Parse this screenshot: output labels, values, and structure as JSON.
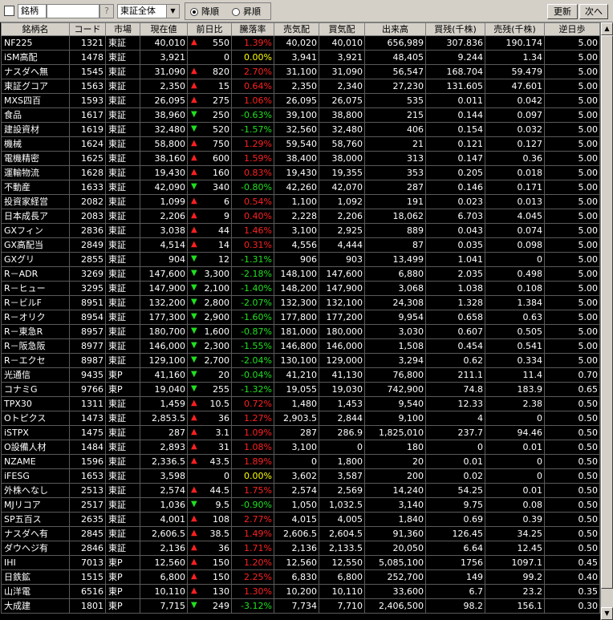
{
  "toolbar": {
    "field_label": "銘柄",
    "field_value": "",
    "help_label": "?",
    "market_select": "東証全体",
    "sort_desc_label": "降順",
    "sort_asc_label": "昇順",
    "sort_selected": "desc",
    "update_label": "更新",
    "next_label": "次へ"
  },
  "colors": {
    "up": "#ff2020",
    "down": "#20e020",
    "flat": "#ffff00",
    "background": "#000000",
    "header_bg": "#d4d0c8"
  },
  "columns": [
    "銘柄名",
    "コード",
    "市場",
    "現在値",
    "前日比",
    "騰落率",
    "売気配",
    "買気配",
    "出来高",
    "買残(千株)",
    "売残(千株)",
    "逆日歩"
  ],
  "rows": [
    {
      "name": "NF225",
      "code": "1321",
      "market": "東証",
      "price": "40,010",
      "dir": "up",
      "change": "550",
      "rate": "1.39%",
      "ask": "40,020",
      "bid": "40,010",
      "volume": "656,989",
      "buy_rem": "307.836",
      "sell_rem": "190.174",
      "gyaku": "5.00"
    },
    {
      "name": "iSM高配",
      "code": "1478",
      "market": "東証",
      "price": "3,921",
      "dir": "flat",
      "change": "0",
      "rate": "0.00%",
      "ask": "3,941",
      "bid": "3,921",
      "volume": "48,405",
      "buy_rem": "9.244",
      "sell_rem": "1.34",
      "gyaku": "5.00"
    },
    {
      "name": "ナスダへ無",
      "code": "1545",
      "market": "東証",
      "price": "31,090",
      "dir": "up",
      "change": "820",
      "rate": "2.70%",
      "ask": "31,100",
      "bid": "31,090",
      "volume": "56,547",
      "buy_rem": "168.704",
      "sell_rem": "59.479",
      "gyaku": "5.00"
    },
    {
      "name": "東証グコア",
      "code": "1563",
      "market": "東証",
      "price": "2,350",
      "dir": "up",
      "change": "15",
      "rate": "0.64%",
      "ask": "2,350",
      "bid": "2,340",
      "volume": "27,230",
      "buy_rem": "131.605",
      "sell_rem": "47.601",
      "gyaku": "5.00"
    },
    {
      "name": "MXS四百",
      "code": "1593",
      "market": "東証",
      "price": "26,095",
      "dir": "up",
      "change": "275",
      "rate": "1.06%",
      "ask": "26,095",
      "bid": "26,075",
      "volume": "535",
      "buy_rem": "0.011",
      "sell_rem": "0.042",
      "gyaku": "5.00"
    },
    {
      "name": "食品",
      "code": "1617",
      "market": "東証",
      "price": "38,960",
      "dir": "down",
      "change": "250",
      "rate": "-0.63%",
      "ask": "39,100",
      "bid": "38,800",
      "volume": "215",
      "buy_rem": "0.144",
      "sell_rem": "0.097",
      "gyaku": "5.00"
    },
    {
      "name": "建設資材",
      "code": "1619",
      "market": "東証",
      "price": "32,480",
      "dir": "down",
      "change": "520",
      "rate": "-1.57%",
      "ask": "32,560",
      "bid": "32,480",
      "volume": "406",
      "buy_rem": "0.154",
      "sell_rem": "0.032",
      "gyaku": "5.00"
    },
    {
      "name": "機械",
      "code": "1624",
      "market": "東証",
      "price": "58,800",
      "dir": "up",
      "change": "750",
      "rate": "1.29%",
      "ask": "59,540",
      "bid": "58,760",
      "volume": "21",
      "buy_rem": "0.121",
      "sell_rem": "0.127",
      "gyaku": "5.00"
    },
    {
      "name": "電機精密",
      "code": "1625",
      "market": "東証",
      "price": "38,160",
      "dir": "up",
      "change": "600",
      "rate": "1.59%",
      "ask": "38,400",
      "bid": "38,000",
      "volume": "313",
      "buy_rem": "0.147",
      "sell_rem": "0.36",
      "gyaku": "5.00"
    },
    {
      "name": "運輸物流",
      "code": "1628",
      "market": "東証",
      "price": "19,430",
      "dir": "up",
      "change": "160",
      "rate": "0.83%",
      "ask": "19,430",
      "bid": "19,355",
      "volume": "353",
      "buy_rem": "0.205",
      "sell_rem": "0.018",
      "gyaku": "5.00"
    },
    {
      "name": "不動産",
      "code": "1633",
      "market": "東証",
      "price": "42,090",
      "dir": "down",
      "change": "340",
      "rate": "-0.80%",
      "ask": "42,260",
      "bid": "42,070",
      "volume": "287",
      "buy_rem": "0.146",
      "sell_rem": "0.171",
      "gyaku": "5.00"
    },
    {
      "name": "投資家経営",
      "code": "2082",
      "market": "東証",
      "price": "1,099",
      "dir": "up",
      "change": "6",
      "rate": "0.54%",
      "ask": "1,100",
      "bid": "1,092",
      "volume": "191",
      "buy_rem": "0.023",
      "sell_rem": "0.013",
      "gyaku": "5.00"
    },
    {
      "name": "日本成長ア",
      "code": "2083",
      "market": "東証",
      "price": "2,206",
      "dir": "up",
      "change": "9",
      "rate": "0.40%",
      "ask": "2,228",
      "bid": "2,206",
      "volume": "18,062",
      "buy_rem": "6.703",
      "sell_rem": "4.045",
      "gyaku": "5.00"
    },
    {
      "name": "GXフィン",
      "code": "2836",
      "market": "東証",
      "price": "3,038",
      "dir": "up",
      "change": "44",
      "rate": "1.46%",
      "ask": "3,100",
      "bid": "2,925",
      "volume": "889",
      "buy_rem": "0.043",
      "sell_rem": "0.074",
      "gyaku": "5.00"
    },
    {
      "name": "GX高配当",
      "code": "2849",
      "market": "東証",
      "price": "4,514",
      "dir": "up",
      "change": "14",
      "rate": "0.31%",
      "ask": "4,556",
      "bid": "4,444",
      "volume": "87",
      "buy_rem": "0.035",
      "sell_rem": "0.098",
      "gyaku": "5.00"
    },
    {
      "name": "GXグリ",
      "code": "2855",
      "market": "東証",
      "price": "904",
      "dir": "down",
      "change": "12",
      "rate": "-1.31%",
      "ask": "906",
      "bid": "903",
      "volume": "13,499",
      "buy_rem": "1.041",
      "sell_rem": "0",
      "gyaku": "5.00"
    },
    {
      "name": "R－ADR",
      "code": "3269",
      "market": "東証",
      "price": "147,600",
      "dir": "down",
      "change": "3,300",
      "rate": "-2.18%",
      "ask": "148,100",
      "bid": "147,600",
      "volume": "6,880",
      "buy_rem": "2.035",
      "sell_rem": "0.498",
      "gyaku": "5.00"
    },
    {
      "name": "R－ヒュー",
      "code": "3295",
      "market": "東証",
      "price": "147,900",
      "dir": "down",
      "change": "2,100",
      "rate": "-1.40%",
      "ask": "148,200",
      "bid": "147,900",
      "volume": "3,068",
      "buy_rem": "1.038",
      "sell_rem": "0.108",
      "gyaku": "5.00"
    },
    {
      "name": "R－ビルF",
      "code": "8951",
      "market": "東証",
      "price": "132,200",
      "dir": "down",
      "change": "2,800",
      "rate": "-2.07%",
      "ask": "132,300",
      "bid": "132,100",
      "volume": "24,308",
      "buy_rem": "1.328",
      "sell_rem": "1.384",
      "gyaku": "5.00"
    },
    {
      "name": "R－オリク",
      "code": "8954",
      "market": "東証",
      "price": "177,300",
      "dir": "down",
      "change": "2,900",
      "rate": "-1.60%",
      "ask": "177,800",
      "bid": "177,200",
      "volume": "9,954",
      "buy_rem": "0.658",
      "sell_rem": "0.63",
      "gyaku": "5.00"
    },
    {
      "name": "R－東急R",
      "code": "8957",
      "market": "東証",
      "price": "180,700",
      "dir": "down",
      "change": "1,600",
      "rate": "-0.87%",
      "ask": "181,000",
      "bid": "180,000",
      "volume": "3,030",
      "buy_rem": "0.607",
      "sell_rem": "0.505",
      "gyaku": "5.00"
    },
    {
      "name": "R－阪急阪",
      "code": "8977",
      "market": "東証",
      "price": "146,000",
      "dir": "down",
      "change": "2,300",
      "rate": "-1.55%",
      "ask": "146,800",
      "bid": "146,000",
      "volume": "1,508",
      "buy_rem": "0.454",
      "sell_rem": "0.541",
      "gyaku": "5.00"
    },
    {
      "name": "R－エクセ",
      "code": "8987",
      "market": "東証",
      "price": "129,100",
      "dir": "down",
      "change": "2,700",
      "rate": "-2.04%",
      "ask": "130,100",
      "bid": "129,000",
      "volume": "3,294",
      "buy_rem": "0.62",
      "sell_rem": "0.334",
      "gyaku": "5.00"
    },
    {
      "name": "光通信",
      "code": "9435",
      "market": "東P",
      "price": "41,160",
      "dir": "down",
      "change": "20",
      "rate": "-0.04%",
      "ask": "41,210",
      "bid": "41,130",
      "volume": "76,800",
      "buy_rem": "211.1",
      "sell_rem": "11.4",
      "gyaku": "0.70"
    },
    {
      "name": "コナミG",
      "code": "9766",
      "market": "東P",
      "price": "19,040",
      "dir": "down",
      "change": "255",
      "rate": "-1.32%",
      "ask": "19,055",
      "bid": "19,030",
      "volume": "742,900",
      "buy_rem": "74.8",
      "sell_rem": "183.9",
      "gyaku": "0.65"
    },
    {
      "name": "TPX30",
      "code": "1311",
      "market": "東証",
      "price": "1,459",
      "dir": "up",
      "change": "10.5",
      "rate": "0.72%",
      "ask": "1,480",
      "bid": "1,453",
      "volume": "9,540",
      "buy_rem": "12.33",
      "sell_rem": "2.38",
      "gyaku": "0.50"
    },
    {
      "name": "Oトピクス",
      "code": "1473",
      "market": "東証",
      "price": "2,853.5",
      "dir": "up",
      "change": "36",
      "rate": "1.27%",
      "ask": "2,903.5",
      "bid": "2,844",
      "volume": "9,100",
      "buy_rem": "4",
      "sell_rem": "0",
      "gyaku": "0.50"
    },
    {
      "name": "iSTPX",
      "code": "1475",
      "market": "東証",
      "price": "287",
      "dir": "up",
      "change": "3.1",
      "rate": "1.09%",
      "ask": "287",
      "bid": "286.9",
      "volume": "1,825,010",
      "buy_rem": "237.7",
      "sell_rem": "94.46",
      "gyaku": "0.50"
    },
    {
      "name": "O設備人材",
      "code": "1484",
      "market": "東証",
      "price": "2,893",
      "dir": "up",
      "change": "31",
      "rate": "1.08%",
      "ask": "3,100",
      "bid": "0",
      "volume": "180",
      "buy_rem": "0",
      "sell_rem": "0.01",
      "gyaku": "0.50"
    },
    {
      "name": "NZAME",
      "code": "1596",
      "market": "東証",
      "price": "2,336.5",
      "dir": "up",
      "change": "43.5",
      "rate": "1.89%",
      "ask": "0",
      "bid": "1,800",
      "volume": "20",
      "buy_rem": "0.01",
      "sell_rem": "0",
      "gyaku": "0.50"
    },
    {
      "name": "iFESG",
      "code": "1653",
      "market": "東証",
      "price": "3,598",
      "dir": "flat",
      "change": "0",
      "rate": "0.00%",
      "ask": "3,602",
      "bid": "3,587",
      "volume": "200",
      "buy_rem": "0.02",
      "sell_rem": "0",
      "gyaku": "0.50"
    },
    {
      "name": "外株へなし",
      "code": "2513",
      "market": "東証",
      "price": "2,574",
      "dir": "up",
      "change": "44.5",
      "rate": "1.75%",
      "ask": "2,574",
      "bid": "2,569",
      "volume": "14,240",
      "buy_rem": "54.25",
      "sell_rem": "0.01",
      "gyaku": "0.50"
    },
    {
      "name": "MJリコア",
      "code": "2517",
      "market": "東証",
      "price": "1,036",
      "dir": "down",
      "change": "9.5",
      "rate": "-0.90%",
      "ask": "1,050",
      "bid": "1,032.5",
      "volume": "3,140",
      "buy_rem": "9.75",
      "sell_rem": "0.08",
      "gyaku": "0.50"
    },
    {
      "name": "SP五百ス",
      "code": "2635",
      "market": "東証",
      "price": "4,001",
      "dir": "up",
      "change": "108",
      "rate": "2.77%",
      "ask": "4,015",
      "bid": "4,005",
      "volume": "1,840",
      "buy_rem": "0.69",
      "sell_rem": "0.39",
      "gyaku": "0.50"
    },
    {
      "name": "ナスダへ有",
      "code": "2845",
      "market": "東証",
      "price": "2,606.5",
      "dir": "up",
      "change": "38.5",
      "rate": "1.49%",
      "ask": "2,606.5",
      "bid": "2,604.5",
      "volume": "91,360",
      "buy_rem": "126.45",
      "sell_rem": "34.25",
      "gyaku": "0.50"
    },
    {
      "name": "ダウヘジ有",
      "code": "2846",
      "market": "東証",
      "price": "2,136",
      "dir": "up",
      "change": "36",
      "rate": "1.71%",
      "ask": "2,136",
      "bid": "2,133.5",
      "volume": "20,050",
      "buy_rem": "6.64",
      "sell_rem": "12.45",
      "gyaku": "0.50"
    },
    {
      "name": "IHI",
      "code": "7013",
      "market": "東P",
      "price": "12,560",
      "dir": "up",
      "change": "150",
      "rate": "1.20%",
      "ask": "12,560",
      "bid": "12,550",
      "volume": "5,085,100",
      "buy_rem": "1756",
      "sell_rem": "1097.1",
      "gyaku": "0.45"
    },
    {
      "name": "日鉄鉱",
      "code": "1515",
      "market": "東P",
      "price": "6,800",
      "dir": "up",
      "change": "150",
      "rate": "2.25%",
      "ask": "6,830",
      "bid": "6,800",
      "volume": "252,700",
      "buy_rem": "149",
      "sell_rem": "99.2",
      "gyaku": "0.40"
    },
    {
      "name": "山洋電",
      "code": "6516",
      "market": "東P",
      "price": "10,110",
      "dir": "up",
      "change": "130",
      "rate": "1.30%",
      "ask": "10,200",
      "bid": "10,110",
      "volume": "33,600",
      "buy_rem": "6.7",
      "sell_rem": "23.2",
      "gyaku": "0.35"
    },
    {
      "name": "大成建",
      "code": "1801",
      "market": "東P",
      "price": "7,715",
      "dir": "down",
      "change": "249",
      "rate": "-3.12%",
      "ask": "7,734",
      "bid": "7,710",
      "volume": "2,406,500",
      "buy_rem": "98.2",
      "sell_rem": "156.1",
      "gyaku": "0.30"
    }
  ]
}
